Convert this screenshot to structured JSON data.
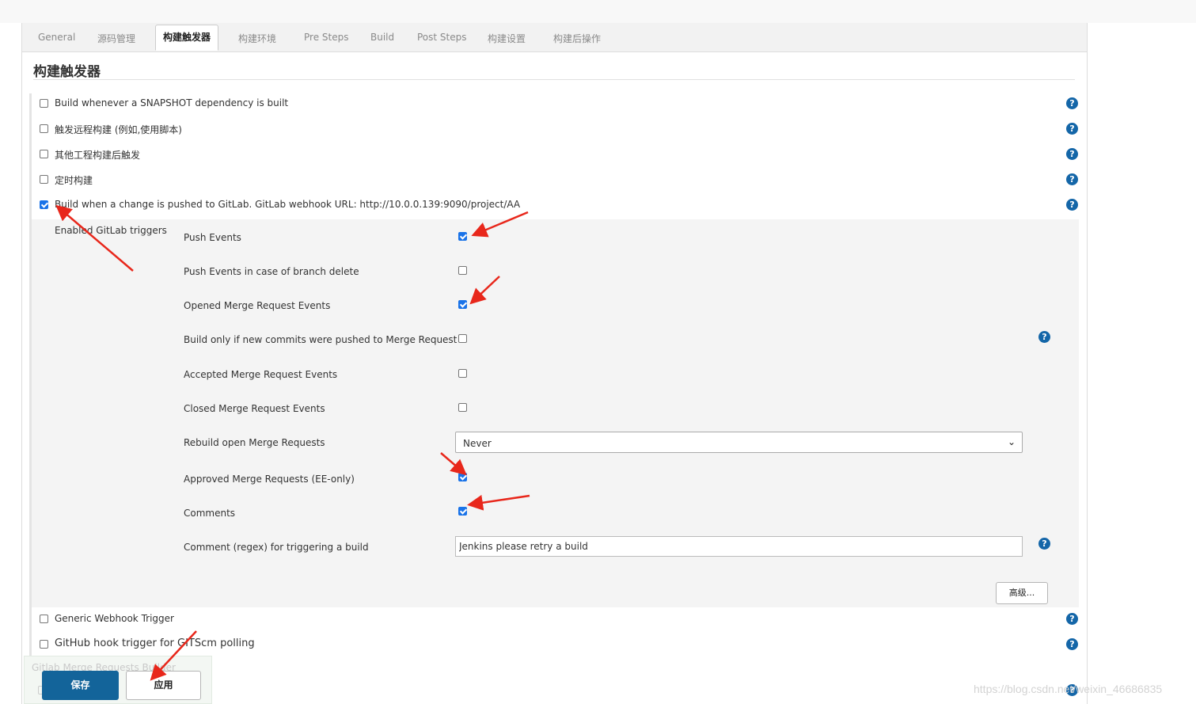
{
  "tabs": [
    {
      "label": "General",
      "active": false
    },
    {
      "label": "源码管理",
      "active": false
    },
    {
      "label": "构建触发器",
      "active": true
    },
    {
      "label": "构建环境",
      "active": false
    },
    {
      "label": "Pre Steps",
      "active": false
    },
    {
      "label": "Build",
      "active": false
    },
    {
      "label": "Post Steps",
      "active": false
    },
    {
      "label": "构建设置",
      "active": false
    },
    {
      "label": "构建后操作",
      "active": false
    }
  ],
  "section": {
    "title": "构建触发器"
  },
  "triggers": [
    {
      "label": "Build whenever a SNAPSHOT dependency is built",
      "checked": false
    },
    {
      "label": "触发远程构建 (例如,使用脚本)",
      "checked": false
    },
    {
      "label": "其他工程构建后触发",
      "checked": false
    },
    {
      "label": "定时构建",
      "checked": false
    },
    {
      "label": "Build when a change is pushed to GitLab. GitLab webhook URL: http://10.0.0.139:9090/project/AA",
      "checked": true
    }
  ],
  "gitlab": {
    "enabled_label": "Enabled GitLab triggers",
    "options": [
      {
        "label": "Push Events",
        "checked": true
      },
      {
        "label": "Push Events in case of branch delete",
        "checked": false
      },
      {
        "label": "Opened Merge Request Events",
        "checked": true
      },
      {
        "label": "Build only if new commits were pushed to Merge Request",
        "checked": false
      },
      {
        "label": "Accepted Merge Request Events",
        "checked": false
      },
      {
        "label": "Closed Merge Request Events",
        "checked": false
      }
    ],
    "rebuild": {
      "label": "Rebuild open Merge Requests",
      "value": "Never"
    },
    "approved": {
      "label": "Approved Merge Requests (EE-only)",
      "checked": true
    },
    "comments": {
      "label": "Comments",
      "checked": true
    },
    "comment_regex": {
      "label": "Comment (regex) for triggering a build",
      "value": "Jenkins please retry a build"
    },
    "advanced_label": "高级..."
  },
  "more_triggers": [
    {
      "label": "Generic Webhook Trigger",
      "checked": false
    },
    {
      "label": "GitHub hook trigger for GITScm polling",
      "checked": false
    }
  ],
  "faded_item": "Gitlab Merge Requests Builder",
  "buttons": {
    "save": "保存",
    "apply": "应用"
  },
  "help_glyph": "?",
  "watermark": "https://blog.csdn.net/weixin_46686835",
  "colors": {
    "primary": "#13649a",
    "checkbox": "#1a73e8",
    "help": "#1466a8",
    "annotation": "#e8271b"
  }
}
